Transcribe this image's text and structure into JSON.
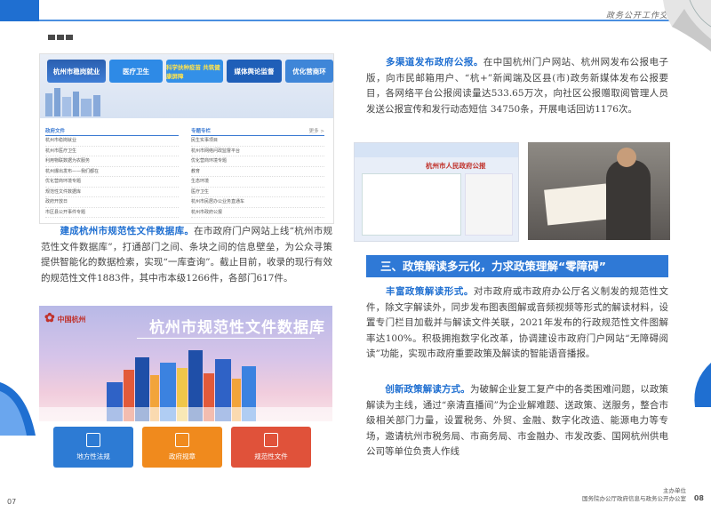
{
  "header": {
    "label": "政务公开工作交"
  },
  "left": {
    "web": {
      "tiles": [
        "杭州市稳岗就业",
        "医疗卫生",
        "科学扶种疫苗 共筑健康屏障",
        "媒体舆论监督",
        "优化营商环"
      ],
      "list_head_1": "政府文件",
      "list_head_2": "专题专栏",
      "more": "更多 >",
      "list_1": [
        "杭州市稳岗就业",
        "杭州市医疗卫生",
        "利用物联数据为农服务",
        "杭州爆出发布——我们都在",
        "优化营商环境专题",
        "规范性文件数据库",
        "政府开放日",
        "市区县公开事件专题"
      ],
      "list_2": [
        "民生实事项目",
        "杭州市网络问政监督平台",
        "优化营商环境专题",
        "教育",
        "生态环境",
        "医疗卫生",
        "杭州市民居办公业务直通车",
        "杭州市政府公报"
      ]
    },
    "caption_hl": "建成杭州市规范性文件数据库。",
    "caption_rest": "在市政府门户网站上线“杭州市规范性文件数据库”，打通部门之间、条块之间的信息壁垒，为公众寻策提供智能化的数据检索，实现“一库查询”。截止目前，收录的现行有效的规范性文件1883件，其中市本级1266件，各部门617件。",
    "db_logo": "中国杭州",
    "db_title": "杭州市规范性文件数据库",
    "buttons": [
      {
        "label": "地方性法规",
        "color": "#2d7bd4"
      },
      {
        "label": "政府规章",
        "color": "#f08a1d"
      },
      {
        "label": "规范性文件",
        "color": "#e0523a"
      }
    ]
  },
  "right": {
    "p1_hl": "多渠道发布政府公报。",
    "p1_rest": "在中国杭州门户网站、杭州网发布公报电子版，向市民邮箱用户、“杭+”新闻端及区县(市)政务新媒体发布公报要目，各网络平台公报阅读量达533.65万次，向社区公报赠取阅管理人员发送公报宣传和发行动态短信 34750条，开展电话回访1176次。",
    "photo_title": "杭州市人民政府公报",
    "section_title": "三、政策解读多元化，力求政策理解“零障碍”",
    "p2_hl": "丰富政策解读形式。",
    "p2_rest": "对市政府或市政府办公厅名义制发的规范性文件，除文字解读外，同步发布图表图解或音频视频等形式的解读材料，设置专门栏目加载并与解读文件关联，2021年发布的行政规范性文件图解率达100%。积极拥抱数字化改革，协调建设市政府门户网站“无障碍阅读”功能，实现市政府重要政策及解读的智能语音播报。",
    "p3_hl": "创新政策解读方式。",
    "p3_rest": "为破解企业复工复产中的各类困难问题，以政策解读为主线，通过“亲清直播间”为企业解难题、送政策、送服务，整合市级相关部门力量，设置税务、外贸、金融、数字化改造、能源电力等专场，邀请杭州市税务局、市商务局、市金融办、市发改委、国网杭州供电公司等单位负责人作线"
  },
  "footer": {
    "left_page": "07",
    "right_page": "08",
    "org_1": "主办单位",
    "org_2": "国务院办公厅政府信息与政务公开办公室"
  },
  "colors": {
    "accent": "#1f6fd1",
    "section_bg": "#2f79d6"
  }
}
